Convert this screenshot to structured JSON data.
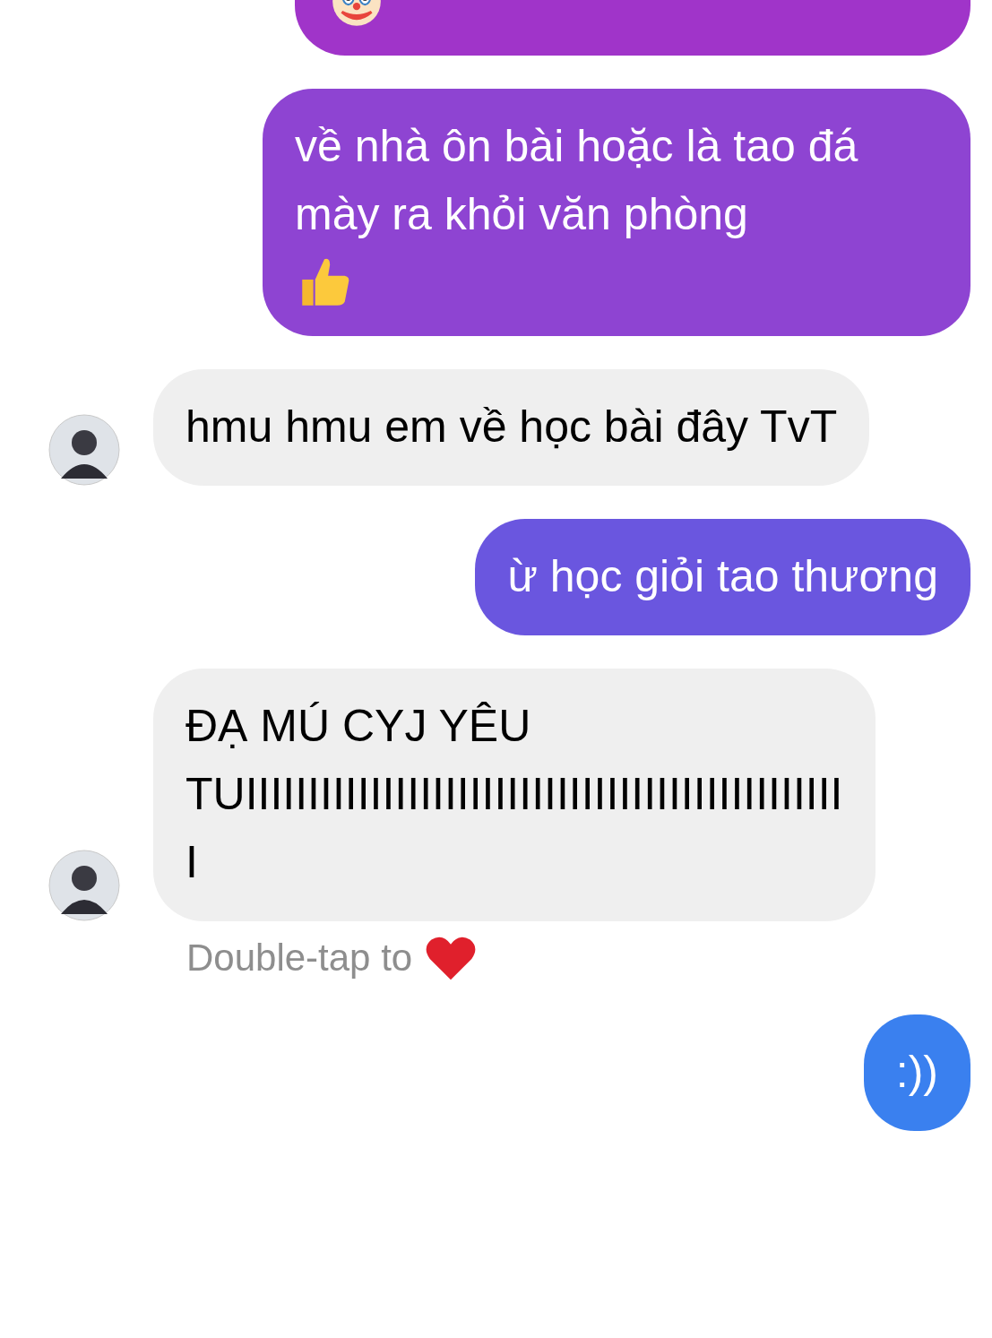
{
  "messages": [
    {
      "kind": "sent",
      "color": "#a034c9",
      "sticker": {
        "kind": "clown"
      }
    },
    {
      "kind": "sent",
      "color": "#8e44d2",
      "text": "về nhà ôn bài hoặc là tao đá mày ra khỏi văn phòng",
      "sticker": {
        "kind": "thumbs-up"
      }
    },
    {
      "kind": "received",
      "text": "hmu hmu em về học bài đây TvT"
    },
    {
      "kind": "sent",
      "color": "#6a56df",
      "text": "ừ học giỏi tao thương"
    },
    {
      "kind": "received",
      "text": "ĐẠ MÚ CYJ YÊU TUIIIIIIIIIIIIIIIIIIIIIIIIIIIIIIIIIIIIIIIIIIIIIIIII"
    },
    {
      "kind": "hint",
      "text": "Double-tap to",
      "sticker": {
        "kind": "heart"
      }
    },
    {
      "kind": "sent",
      "color": "#3a80ef",
      "text": ":))"
    }
  ]
}
